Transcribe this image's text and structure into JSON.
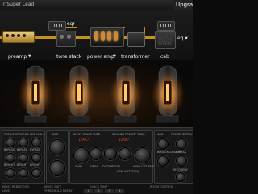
{
  "window": {
    "preset_name": "r Super Lead",
    "upgrade_label": "Upgrad"
  },
  "chain": {
    "labels": {
      "preamp": "preamp",
      "eq1": "eq",
      "tone_stack": "tone stack",
      "power_amp": "power amp",
      "transformer": "transformer",
      "cab": "cab",
      "eq2": "eq"
    },
    "accent_color": "#c79019"
  },
  "tubes": {
    "count": 4
  },
  "panel": {
    "left_knobs": [
      "PRE LOW",
      "PRE MID",
      "PRE HIGH",
      "BYPASS",
      "BYPASS",
      "BYPASS",
      "BRIGHT",
      "BRIGHT",
      "BRIGHT"
    ],
    "bias_label": "BIAS",
    "input_stage_label": "INPUT STAGE TUBE",
    "input_stage_value": "12AX7",
    "second_stage_label": "SECOND PREAMP TUBE",
    "second_stage_value": "12AX7",
    "mid_knobs": [
      "GAIN",
      "DRIVE",
      "DISTORTION",
      "LOW CUT FREQ",
      "HIGH CUT FREQ"
    ],
    "right_labels": {
      "sag": "SAG",
      "bias_excursion": "BIAS EXCURSION",
      "power_supply": "POWER SUPPLY",
      "bypass": "BYPASS",
      "recovery": "RECOVERY"
    }
  },
  "bottombar": {
    "sections": [
      "NOISE REDUCTION",
      "NOISE GATE",
      "QUICK SNAP",
      "ROOM CONTROL"
    ],
    "snap_buttons": [
      "1",
      "2",
      "3",
      "4"
    ],
    "tiny_labels": [
      "LEVEL",
      "THRESHOLD",
      "DECAY"
    ]
  }
}
